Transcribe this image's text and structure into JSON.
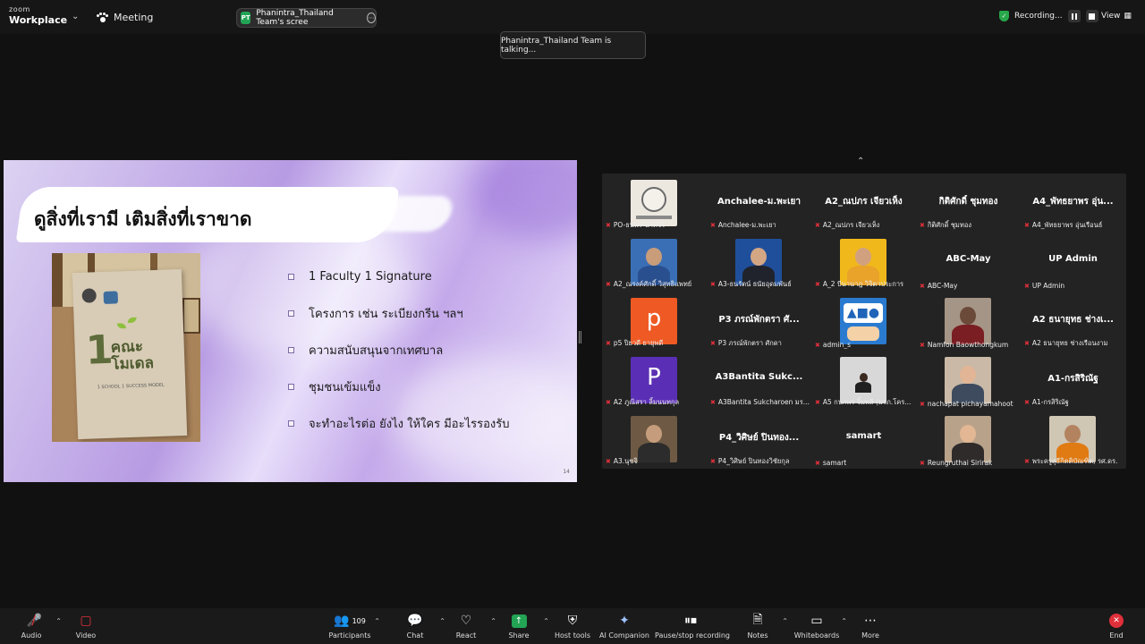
{
  "app": {
    "logo_line1": "zoom",
    "logo_line2": "Workplace",
    "meeting_label": "Meeting"
  },
  "share_pill": {
    "initials": "PT",
    "label": "Phanintra_Thailand Team's scree"
  },
  "recording": {
    "label": "Recording..."
  },
  "view_label": "View",
  "talking_toast": "Phanintra_Thailand Team is talking...",
  "slide": {
    "title": "ดูสิ่งที่เรามี เติมสิ่งที่เราขาด",
    "book_text": "1 คณะ โมเดล",
    "book_number": "1",
    "book_word1": "คณะ",
    "book_word2": "โมเดล",
    "book_sub": "1 SCHOOL 1 SUCCESS MODEL",
    "bullets": [
      "1 Faculty 1 Signature",
      "โครงการ เช่น ระเบียงกรีน ฯลฯ",
      "ความสนับสนุนจากเทศบาล",
      "ชุมชนเข้มแข็ง",
      "จะทำอะไรต่อ ยังไง ให้ใคร มีอะไรรองรับ"
    ],
    "page_number": "14"
  },
  "gallery": {
    "tiles": [
      {
        "kind": "photo-logo",
        "caption": "PO-ธนพร-นาคจริ"
      },
      {
        "kind": "name",
        "big": "Anchalee-ม.พะเยา",
        "caption": "Anchalee-ม.พะเยา"
      },
      {
        "kind": "name",
        "big": "A2_ณปภร เจียวเห็ง",
        "caption": "A2_ณปภร เจียวเห็ง"
      },
      {
        "kind": "name",
        "big": "กิติศักดิ์ ชุมทอง",
        "caption": "กิติศักดิ์ ชุมทอง"
      },
      {
        "kind": "name",
        "big": "A4_พัทธยาพร อุ่น...",
        "caption": "A4_พัทธยาพร อุ่นเรือนธ์"
      },
      {
        "kind": "photo-man-blue",
        "caption": "A2_ณรงค์ศักดิ์ วิสุทธิแพทย์"
      },
      {
        "kind": "photo-man-suit",
        "caption": "A3-ธนรัตน์ ธนัยอุดมพันธ์"
      },
      {
        "kind": "photo-woman-yellow",
        "caption": "A_2 บีนานาฎ วิจิตาประการ"
      },
      {
        "kind": "name",
        "big": "ABC-May",
        "caption": "ABC-May"
      },
      {
        "kind": "name",
        "big": "UP Admin",
        "caption": "UP Admin"
      },
      {
        "kind": "letter-orange",
        "letter": "p",
        "caption": "p5 ปิยวดี ยายุพดี"
      },
      {
        "kind": "name",
        "big": "P3 ภรณ์พักตรา ศั...",
        "caption": "P3 ภรณ์พักตรา ศักดา"
      },
      {
        "kind": "photo-abc",
        "caption": "admin_s"
      },
      {
        "kind": "photo-woman-office",
        "caption": "Namfon Baowthongkum"
      },
      {
        "kind": "name",
        "big": "A2 ธนายุทธ ช่างเ...",
        "caption": "A2 ธนายุทธ ช่างเรือนงาม"
      },
      {
        "kind": "letter-purple",
        "letter": "P",
        "caption": "A2 ภูณิสรา ลิ้มนนทกุล"
      },
      {
        "kind": "name",
        "big": "A3Bantita Sukc...",
        "caption": "A3Bantita Sukcharoen มร..."
      },
      {
        "kind": "photo-woman-room",
        "caption": "A5 กนกพร จิ้มพลี (มรภ.โคร..."
      },
      {
        "kind": "photo-woman-glasses",
        "caption": "nachapat pichayamahoot"
      },
      {
        "kind": "name",
        "big": "A1-กรสิริณัฐ",
        "caption": "A1-กรสิริณัฐ"
      },
      {
        "kind": "photo-woman-desk",
        "caption": "A3.นุชจิ"
      },
      {
        "kind": "name",
        "big": "P4_วิศิษย์ ปินทอง...",
        "caption": "P4_วิศิษย์ ปินทองวิชัยกุล"
      },
      {
        "kind": "name",
        "big": "samart",
        "caption": "samart"
      },
      {
        "kind": "photo-woman-smile",
        "caption": "Reungruthai Sirirak"
      },
      {
        "kind": "photo-monk",
        "caption": "พระครูสุธีกิตติบัณฑิต, รศ.ดร."
      }
    ]
  },
  "toolbar": {
    "audio": "Audio",
    "video": "Video",
    "participants": "Participants",
    "participants_count": "109",
    "chat": "Chat",
    "react": "React",
    "share": "Share",
    "host_tools": "Host tools",
    "ai_companion": "AI Companion",
    "pause_recording": "Pause/stop recording",
    "notes": "Notes",
    "whiteboards": "Whiteboards",
    "more": "More",
    "end": "End"
  },
  "colors": {
    "accent_green": "#23a455",
    "mute_red": "#e0303a",
    "background": "#111111"
  }
}
